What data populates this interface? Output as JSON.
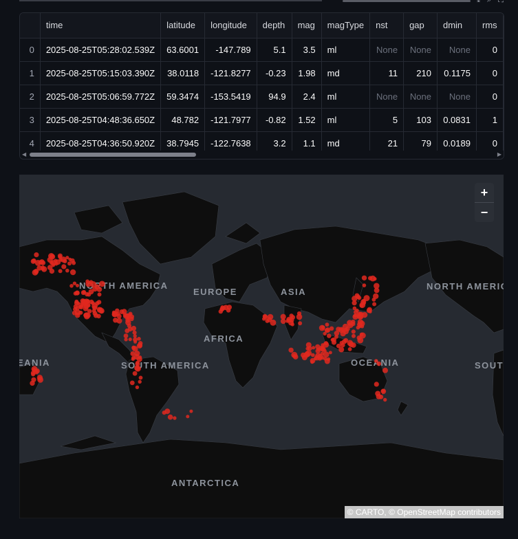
{
  "table": {
    "columns": [
      "",
      "time",
      "latitude",
      "longitude",
      "depth",
      "mag",
      "magType",
      "nst",
      "gap",
      "dmin",
      "rms"
    ],
    "rows": [
      {
        "idx": "0",
        "time": "2025-08-25T05:28:02.539Z",
        "latitude": "63.6001",
        "longitude": "-147.789",
        "depth": "5.1",
        "mag": "3.5",
        "magType": "ml",
        "nst": "None",
        "gap": "None",
        "dmin": "None",
        "rms": "0"
      },
      {
        "idx": "1",
        "time": "2025-08-25T05:15:03.390Z",
        "latitude": "38.0118",
        "longitude": "-121.8277",
        "depth": "-0.23",
        "mag": "1.98",
        "magType": "md",
        "nst": "11",
        "gap": "210",
        "dmin": "0.1175",
        "rms": "0"
      },
      {
        "idx": "2",
        "time": "2025-08-25T05:06:59.772Z",
        "latitude": "59.3474",
        "longitude": "-153.5419",
        "depth": "94.9",
        "mag": "2.4",
        "magType": "ml",
        "nst": "None",
        "gap": "None",
        "dmin": "None",
        "rms": "0"
      },
      {
        "idx": "3",
        "time": "2025-08-25T04:48:36.650Z",
        "latitude": "48.782",
        "longitude": "-121.7977",
        "depth": "-0.82",
        "mag": "1.52",
        "magType": "ml",
        "nst": "5",
        "gap": "103",
        "dmin": "0.0831",
        "rms": "1"
      },
      {
        "idx": "4",
        "time": "2025-08-25T04:36:50.920Z",
        "latitude": "38.7945",
        "longitude": "-122.7638",
        "depth": "3.2",
        "mag": "1.1",
        "magType": "md",
        "nst": "21",
        "gap": "79",
        "dmin": "0.0189",
        "rms": "0"
      }
    ]
  },
  "map": {
    "zoom_in": "+",
    "zoom_out": "−",
    "labels": [
      "NORTH AMERICA",
      "EUROPE",
      "ASIA",
      "AFRICA",
      "SOUTH AMERICA",
      "OCEANIA",
      "ANTARCTICA",
      "NORTH AMERICA",
      "EANIA",
      "SOUTH AMERICA"
    ],
    "attribution_carto": "© CARTO",
    "attribution_osm": "© OpenStreetMap",
    "attribution_contrib": "contributors",
    "marker_color": "#e0281e",
    "land_color": "#0e0e0e",
    "water_color": "#262a31"
  }
}
